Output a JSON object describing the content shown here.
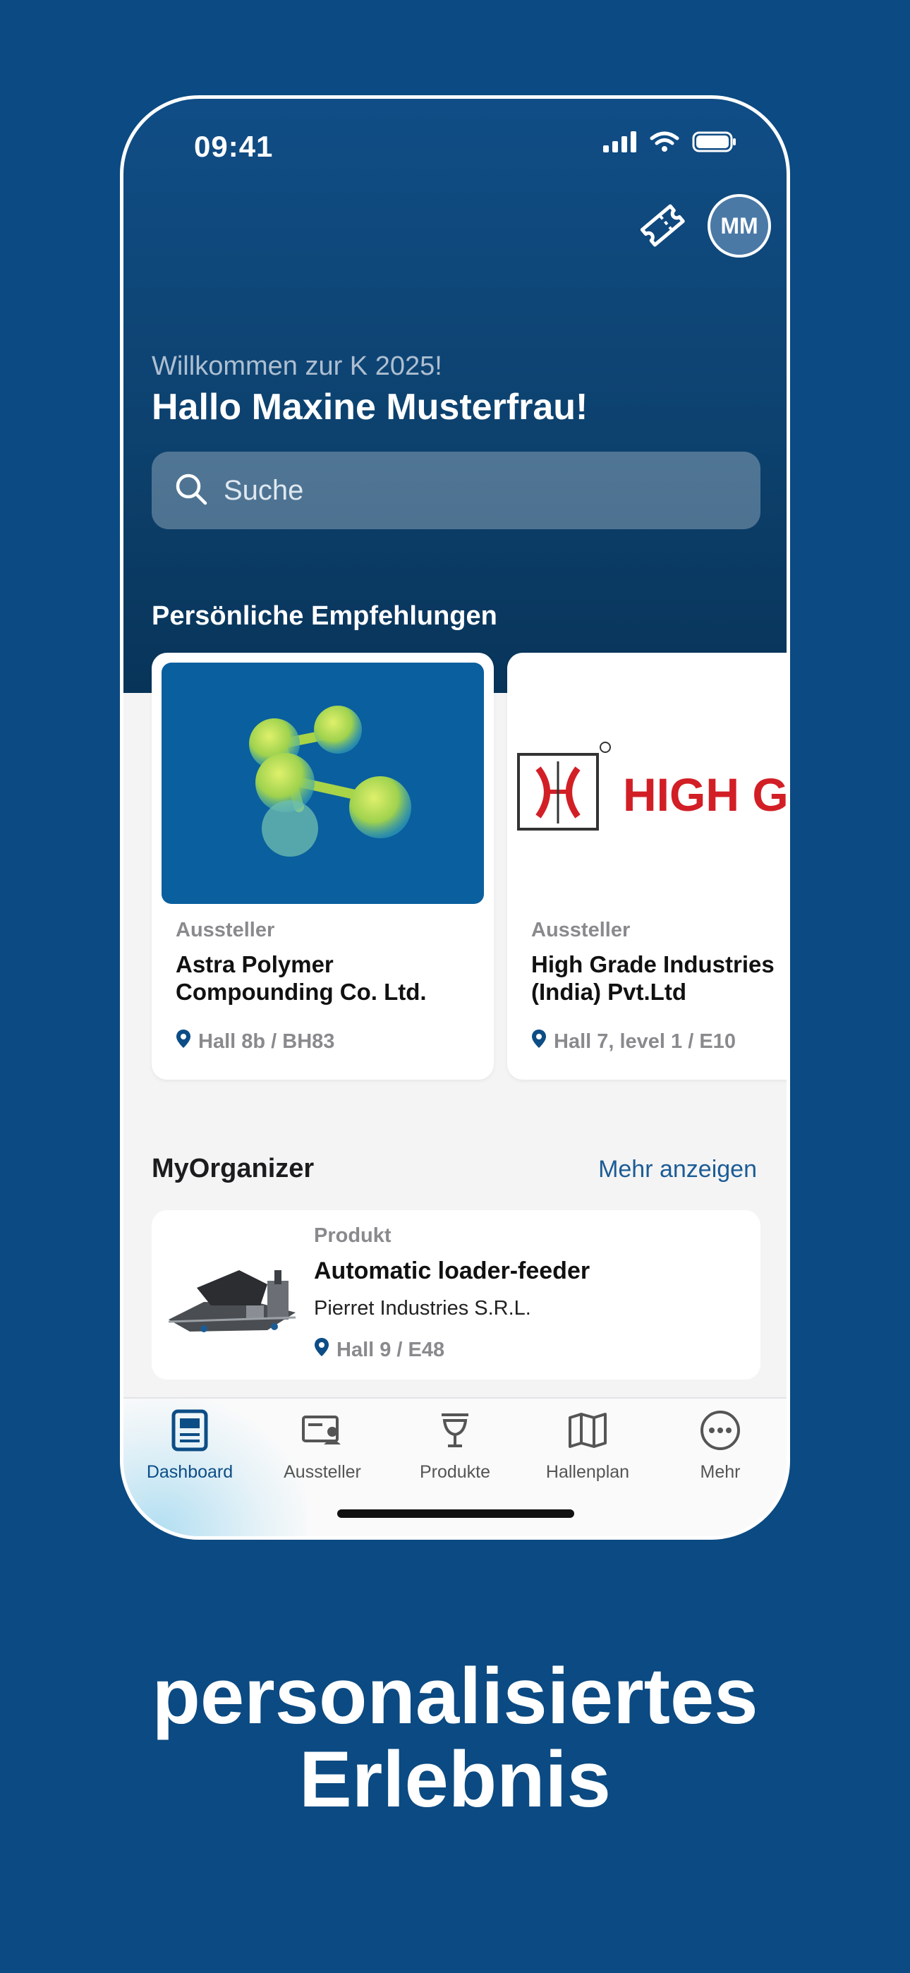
{
  "status_bar": {
    "time": "09:41"
  },
  "header": {
    "avatar_initials": "MM",
    "ticket_icon": "ticket-icon"
  },
  "welcome": {
    "subtitle": "Willkommen zur K 2025!",
    "greeting": "Hallo Maxine Musterfrau!"
  },
  "search": {
    "placeholder": "Suche"
  },
  "recommendations": {
    "title": "Persönliche Empfehlungen",
    "cards": [
      {
        "kind": "Aussteller",
        "name": "Astra Polymer Compounding Co. Ltd.",
        "location": "Hall 8b / BH83"
      },
      {
        "kind": "Aussteller",
        "name": "High Grade Industries (India) Pvt.Ltd",
        "location": "Hall 7, level 1 / E10",
        "logo_text": "HIGH GRA"
      }
    ]
  },
  "organizer": {
    "title": "MyOrganizer",
    "more_label": "Mehr anzeigen",
    "item": {
      "kind": "Produkt",
      "name": "Automatic loader-feeder",
      "company": "Pierret Industries S.R.L.",
      "location": "Hall 9 / E48"
    }
  },
  "tabbar": {
    "tabs": [
      {
        "label": "Dashboard",
        "icon": "dashboard-icon"
      },
      {
        "label": "Aussteller",
        "icon": "exhibitor-icon"
      },
      {
        "label": "Produkte",
        "icon": "product-icon"
      },
      {
        "label": "Hallenplan",
        "icon": "map-icon"
      },
      {
        "label": "Mehr",
        "icon": "more-icon"
      }
    ]
  },
  "tagline": {
    "line1": "personalisiertes",
    "line2": "Erlebnis"
  },
  "colors": {
    "background": "#0b4a82",
    "accent": "#0d4d86",
    "link": "#1c5c95"
  }
}
